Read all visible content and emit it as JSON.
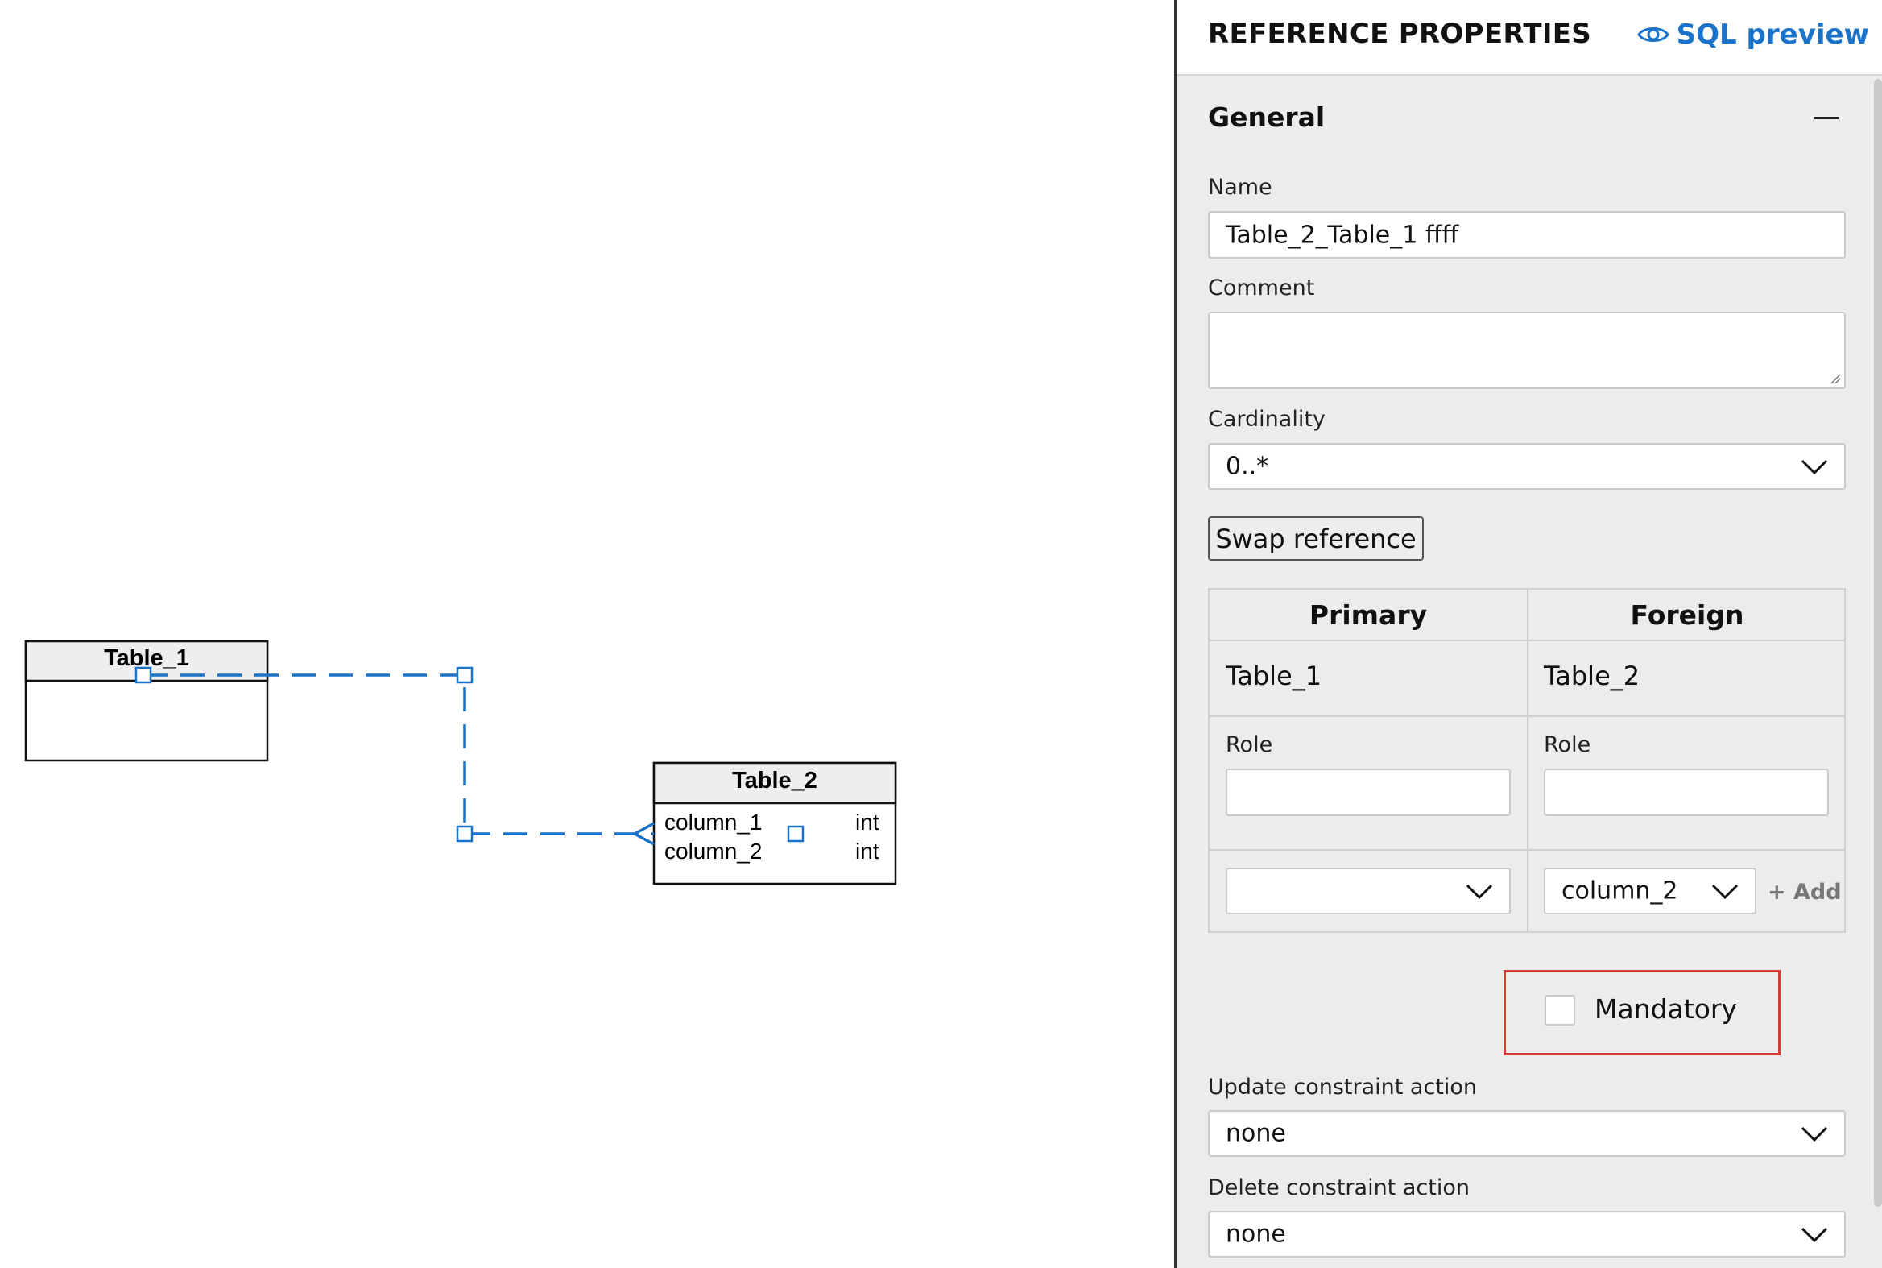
{
  "canvas": {
    "table_1": {
      "title": "Table_1",
      "columns": []
    },
    "table_2": {
      "title": "Table_2",
      "columns": [
        {
          "name": "column_1",
          "type": "int"
        },
        {
          "name": "column_2",
          "type": "int"
        }
      ]
    },
    "colors": {
      "reference_line": "#1a73c8",
      "table_header": "#eeeeee"
    }
  },
  "panel": {
    "title": "REFERENCE PROPERTIES",
    "sql_preview": "SQL preview",
    "section_general": "General",
    "name_label": "Name",
    "name_value": "Table_2_Table_1 ffff",
    "comment_label": "Comment",
    "comment_value": "",
    "cardinality_label": "Cardinality",
    "cardinality_value": "0..*",
    "swap_button": "Swap reference",
    "grid": {
      "primary_header": "Primary",
      "foreign_header": "Foreign",
      "primary_table": "Table_1",
      "foreign_table": "Table_2",
      "primary_role_label": "Role",
      "foreign_role_label": "Role",
      "primary_role_value": "",
      "foreign_role_value": "",
      "primary_column_value": "",
      "foreign_column_value": "column_2",
      "add_label": "+ Add"
    },
    "mandatory_label": "Mandatory",
    "mandatory_checked": false,
    "update_label": "Update constraint action",
    "update_value": "none",
    "delete_label": "Delete constraint action",
    "delete_value": "none",
    "accent_color": "#1a73c8",
    "highlight_color": "#d63a3a"
  }
}
